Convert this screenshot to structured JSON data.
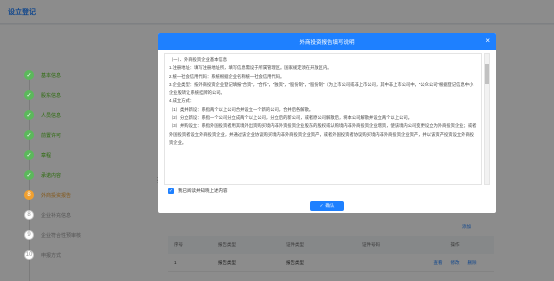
{
  "header": {
    "title": "设立登记"
  },
  "steps": [
    {
      "num": "✓",
      "label": "基本信息",
      "state": "done"
    },
    {
      "num": "✓",
      "label": "股东信息",
      "state": "done"
    },
    {
      "num": "✓",
      "label": "人员信息",
      "state": "done"
    },
    {
      "num": "✓",
      "label": "前置许可",
      "state": "done"
    },
    {
      "num": "✓",
      "label": "章程",
      "state": "done"
    },
    {
      "num": "✓",
      "label": "承诺内容",
      "state": "done"
    },
    {
      "num": "8",
      "label": "外商投资报告",
      "state": "active"
    },
    {
      "num": "8",
      "label": "企业补充信息",
      "state": "todo"
    },
    {
      "num": "9",
      "label": "企业符合性预审核",
      "state": "todo"
    },
    {
      "num": "10",
      "label": "申报方式",
      "state": "todo"
    }
  ],
  "content_side_char": "投",
  "table": {
    "add_label": "添加",
    "headers": [
      "序号",
      "报告类型",
      "证件类型",
      "证件号码",
      "操作"
    ],
    "rows": [
      {
        "index": "1",
        "type": "报告类型",
        "id_type": "报告类型",
        "id_no": "",
        "actions": [
          "查看",
          "修改",
          "删除"
        ]
      }
    ]
  },
  "modal": {
    "title": "外商投资报告填写说明",
    "close_label": "×",
    "paragraphs": [
      "（一）、外商投资企业基本信息",
      "1.注册地址：填写注册地址所，填写信息需设于所属管理区。国家规定须在开放区内。",
      "2.统一社会信用代码：系统根据企业名称统一社会信用代码。",
      "3.企业类型：按外商投资企业登记填报“合资”，“合作”，“独资”，“股份制”，“股份制”（为上市公司或非上市公司，其中非上市公司中，“公众公司”根据登记信息中小企业股转让系统挂牌的公司。",
      "4.成立方式：",
      "（1）类并新设：系指两个以上公司合并设立一个新的公司，合并后各解散。",
      "（2）分立新设：系指一个公司分立成两个以上公司，分立后的新公司，或者原公司解散后，将本公司解散并设立两个以上公司。",
      "（3）并购设立：系指外国投资者用其境外出资购买境内非外资投资企业股东的股权或认购境内非外商投资企业增资，使该境内公司变更设立为外商投资企业；或者外国投资者设立外商投资企业，并通过该企业协议购买境内非外商投资企业资产，或者外国投资者协议购买境内非外商投资企业资产，并以该资产投资设立外商投资企业。"
    ],
    "checkbox_label": "我已阅读并知晓上述内容",
    "confirm_label": "确认"
  }
}
